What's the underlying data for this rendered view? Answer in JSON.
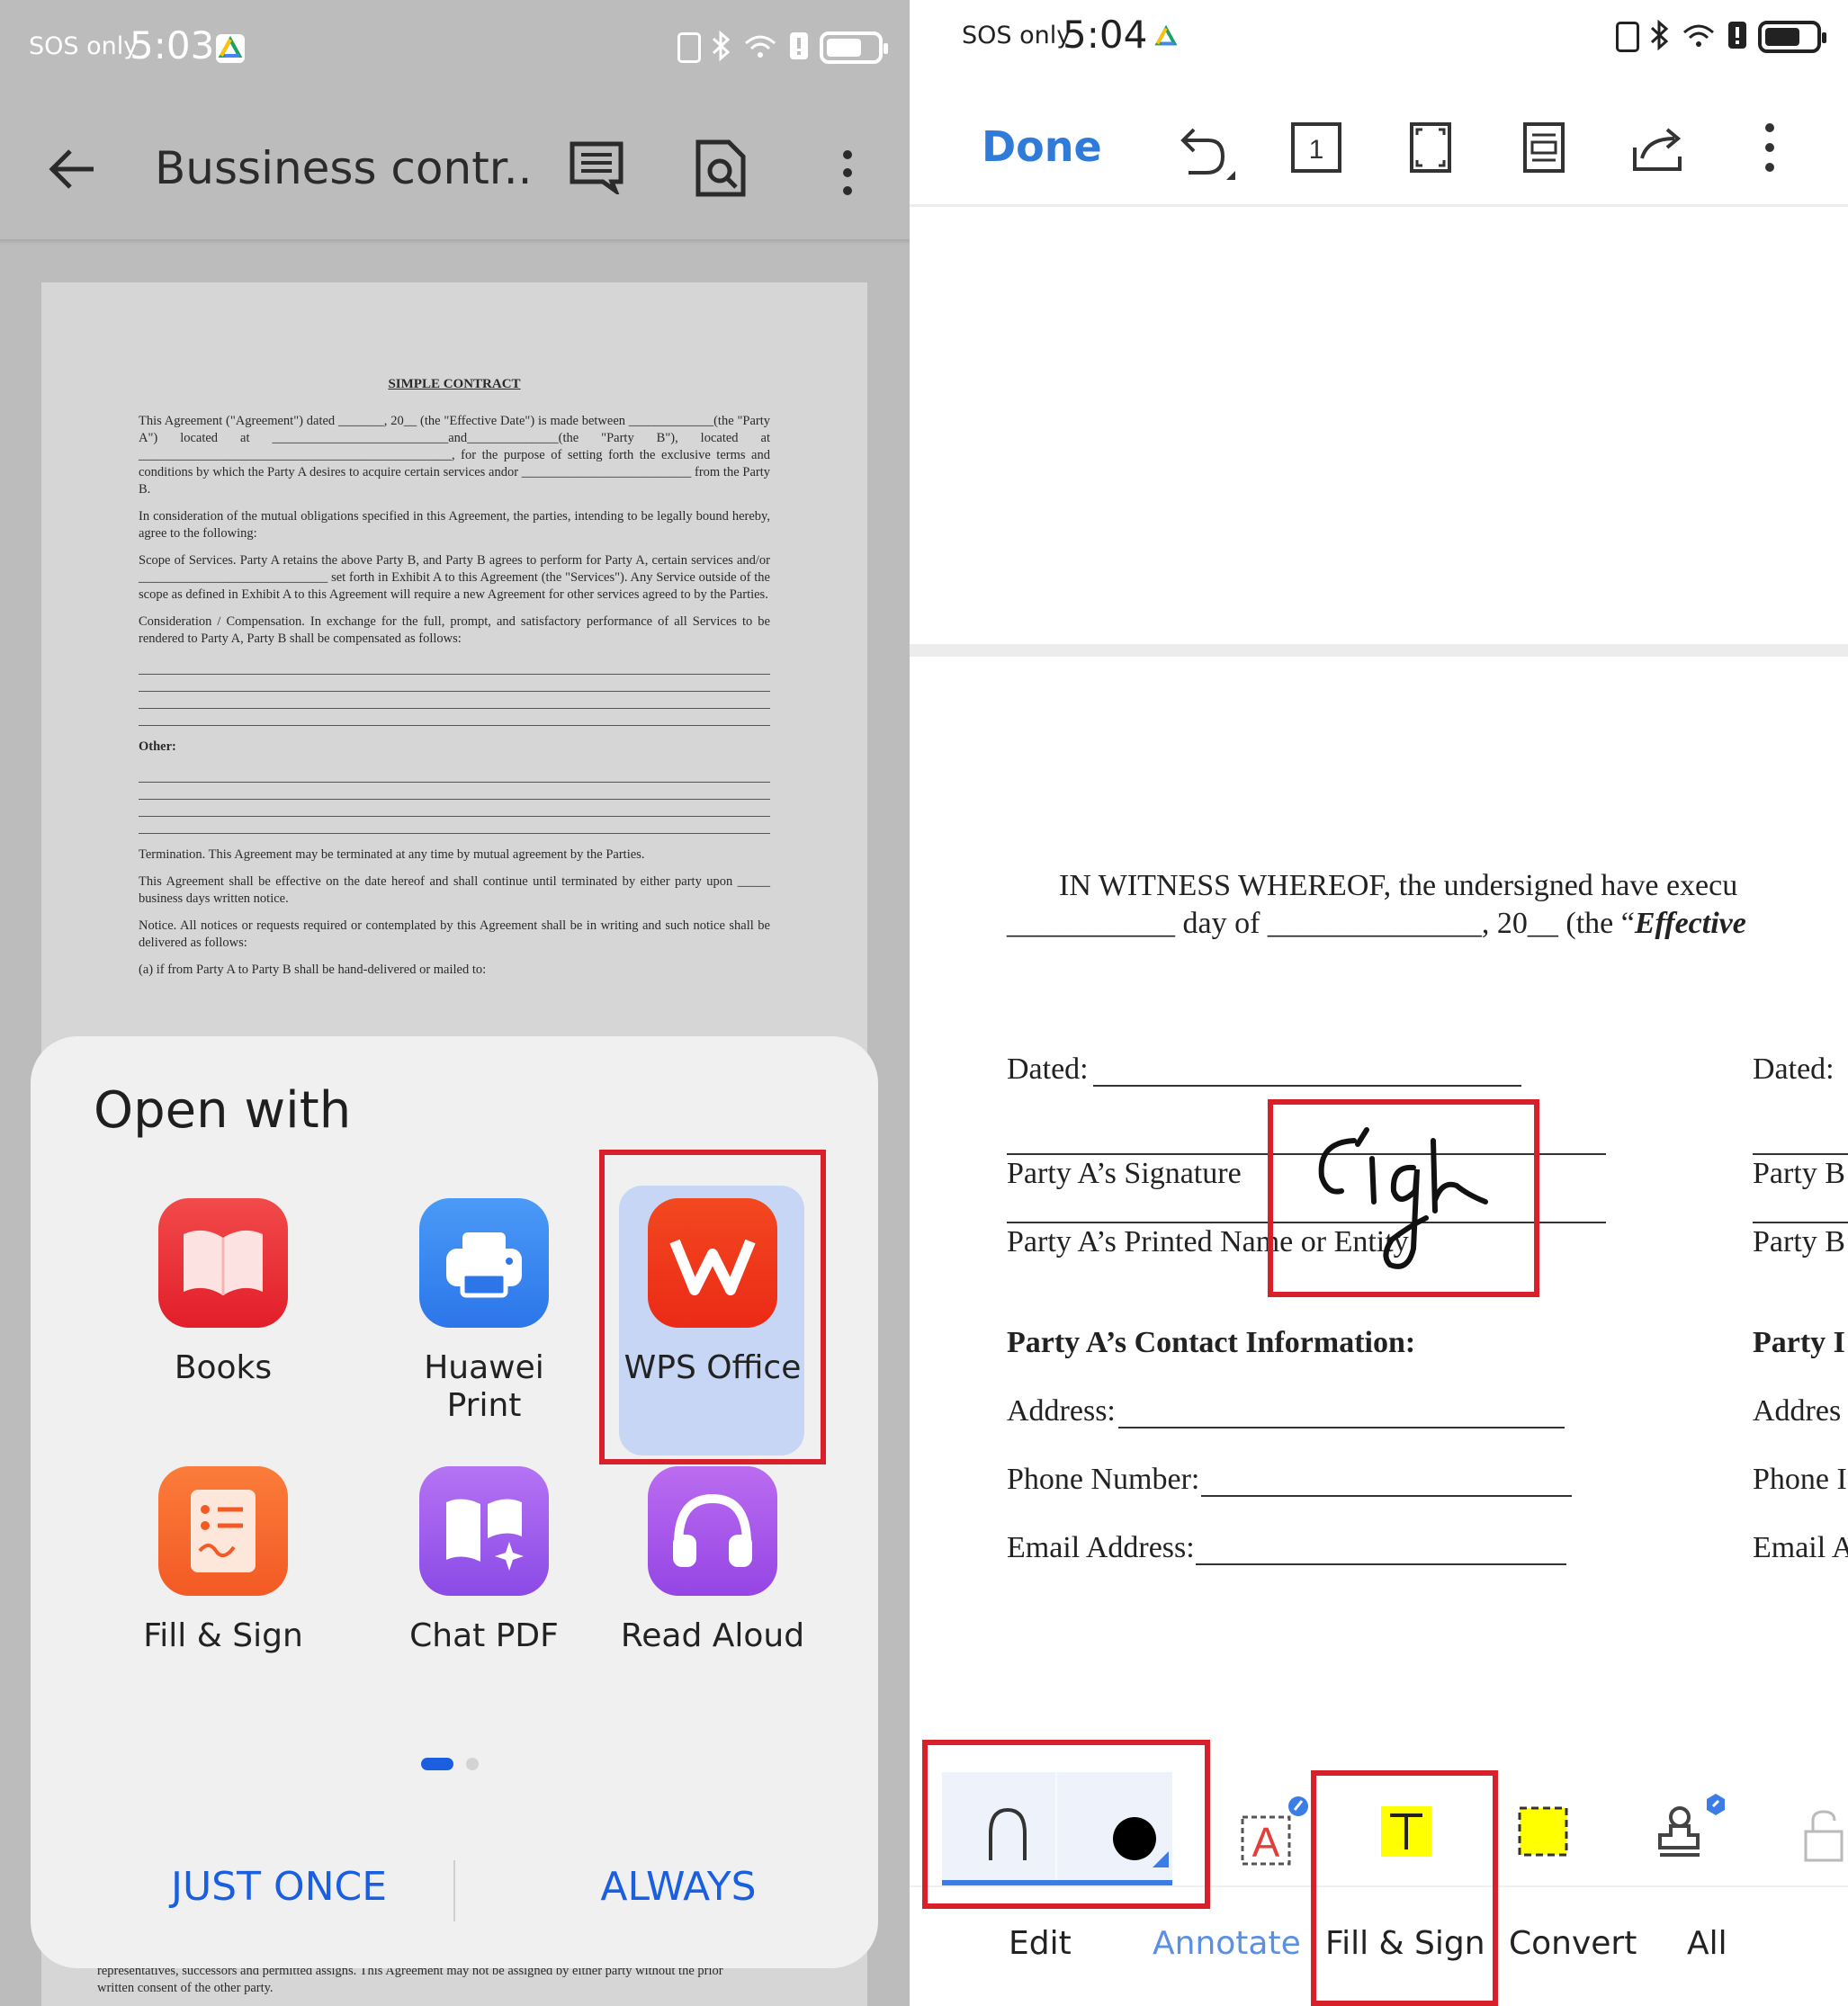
{
  "left": {
    "status": {
      "sos": "SOS only",
      "time": "5:03"
    },
    "appbar": {
      "title": "Bussiness contr..."
    },
    "document": {
      "title": "SIMPLE CONTRACT",
      "paragraphs": [
        "This Agreement (\"Agreement\") dated _______, 20__ (the \"Effective Date\") is made between _____________(the \"Party A\") located at ___________________________and______________(the \"Party B\"), located at ________________________________________________, for the purpose of setting forth the exclusive terms and conditions by which the Party A desires to acquire certain services andor __________________________ from the Party B.",
        "In consideration of the mutual obligations specified in this Agreement, the parties, intending to be legally bound hereby, agree to the following:",
        "Scope of Services. Party A retains the above Party B, and Party B agrees to perform for Party A, certain services and/or _____________________________ set forth in Exhibit A to this Agreement (the \"Services\"). Any Service outside of the scope as defined in Exhibit A to this Agreement will require a new Agreement for other services agreed to by the Parties.",
        "Consideration / Compensation. In exchange for the full, prompt, and satisfactory performance of all Services to be rendered to Party A, Party B shall be compensated as follows:"
      ],
      "other_label": "Other:",
      "paragraphs2": [
        "Termination. This Agreement may be terminated at any time by mutual agreement by the Parties.",
        "This Agreement shall be effective on the date hereof and shall continue until terminated by either party upon _____ business days written notice.",
        "Notice. All notices or requests required or contemplated by this Agreement shall be in writing and such notice shall be delivered as follows:",
        "(a) if from Party A to Party B shall be hand-delivered or mailed to:"
      ],
      "bottom_text": "representatives, successors and permitted assigns. This Agreement may not be assigned by either party without the prior written consent of the other party."
    },
    "sheet": {
      "heading": "Open with",
      "apps": [
        {
          "label": "Books",
          "icon": "books-icon"
        },
        {
          "label": "Huawei Print",
          "icon": "printer-icon"
        },
        {
          "label": "WPS Office",
          "icon": "wps-office-icon"
        },
        {
          "label": "Fill & Sign",
          "icon": "fill-sign-icon"
        },
        {
          "label": "Chat PDF",
          "icon": "chat-pdf-icon"
        },
        {
          "label": "Read Aloud",
          "icon": "headphones-icon"
        }
      ],
      "just_once": "JUST ONCE",
      "always": "ALWAYS"
    }
  },
  "right": {
    "status": {
      "sos": "SOS only",
      "time": "5:04"
    },
    "toolbar": {
      "done": "Done",
      "page_number": "1"
    },
    "document": {
      "witness_line1": "IN  WITNESS  WHEREOF,  the  undersigned  have  execu",
      "witness_line2_a": "___________ day of ______________, 20__ (the “",
      "witness_line2_b": "Effective",
      "dated_label": "Dated:",
      "dated_right": "Dated:",
      "party_a_signature": "Party A’s Signature",
      "party_a_printed": "Party A’s Printed Name or Entity",
      "party_b_sig_partial": "Party B",
      "party_b_name_partial": "Party B",
      "party_a_contact": "Party A’s Contact Information:",
      "party_b_contact_partial": "Party I",
      "address": "Address:",
      "address_right": "Addres",
      "phone": "Phone Number:",
      "phone_right": "Phone I",
      "email": "Email Address:",
      "email_right": "Email A",
      "signature_text": "Sign"
    },
    "bottom_tabs": [
      {
        "label": "Edit"
      },
      {
        "label": "Annotate"
      },
      {
        "label": "Fill & Sign"
      },
      {
        "label": "Convert"
      },
      {
        "label": "All"
      }
    ],
    "colors": {
      "accent": "#2f7bd9",
      "highlight_red": "#d8202a",
      "fill_yellow": "#ffff00"
    }
  }
}
